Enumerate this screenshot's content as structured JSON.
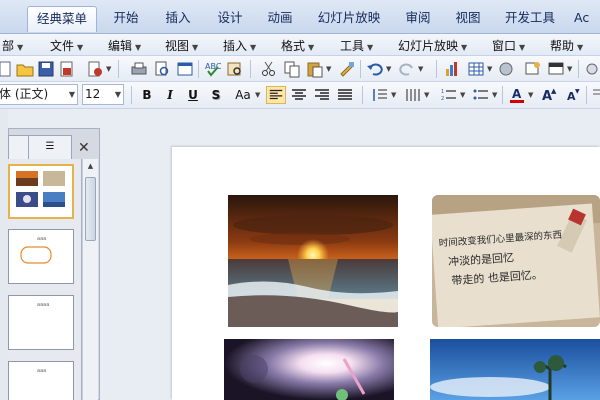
{
  "ribbon_tabs": [
    "经典菜单",
    "开始",
    "插入",
    "设计",
    "动画",
    "幻灯片放映",
    "审阅",
    "视图",
    "开发工具",
    "Ac"
  ],
  "menu_items": [
    "部",
    "文件",
    "编辑",
    "视图",
    "插入",
    "格式",
    "工具",
    "幻灯片放映",
    "窗口",
    "帮助"
  ],
  "font": {
    "name": "体 (正文)",
    "size": "12"
  },
  "format_buttons": {
    "bold": "B",
    "italic": "I",
    "underline": "U",
    "shadow": "S",
    "case": "Aa"
  },
  "outline_tab": "☰",
  "close_glyph": "✕",
  "thumb_labels": [
    "aaa",
    "aaaa",
    "aaa",
    "aaaa"
  ],
  "note_lines": [
    "时间改变我们心里最深的东西",
    "冲淡的是回忆",
    "带走的 也是回忆。"
  ],
  "accent_color": "#e8b24a",
  "font_color": "#d40000"
}
